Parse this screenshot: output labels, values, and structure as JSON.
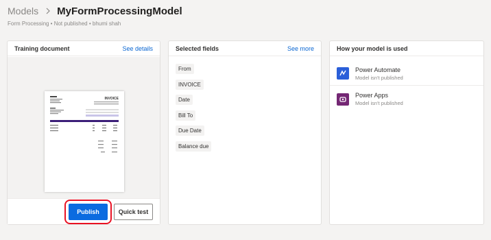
{
  "breadcrumb": {
    "root": "Models",
    "current": "MyFormProcessingModel"
  },
  "subtitle": "Form Processing • Not published • bhumi shah",
  "colors": {
    "accent": "#0b6be0",
    "highlight": "#e81123",
    "power_automate": "#2b5fd9",
    "power_apps": "#742774"
  },
  "training_card": {
    "title": "Training document",
    "link": "See details",
    "publish_label": "Publish",
    "quicktest_label": "Quick test"
  },
  "fields_card": {
    "title": "Selected fields",
    "link": "See more",
    "fields": [
      "From",
      "INVOICE",
      "Date",
      "Bill To",
      "Due Date",
      "Balance due"
    ]
  },
  "usage_card": {
    "title": "How your model is used",
    "items": [
      {
        "name": "Power Automate",
        "status": "Model isn't published",
        "icon": "power-automate-icon"
      },
      {
        "name": "Power Apps",
        "status": "Model isn't published",
        "icon": "power-apps-icon"
      }
    ]
  },
  "document_thumbnail": {
    "heading": "INVOICE"
  }
}
